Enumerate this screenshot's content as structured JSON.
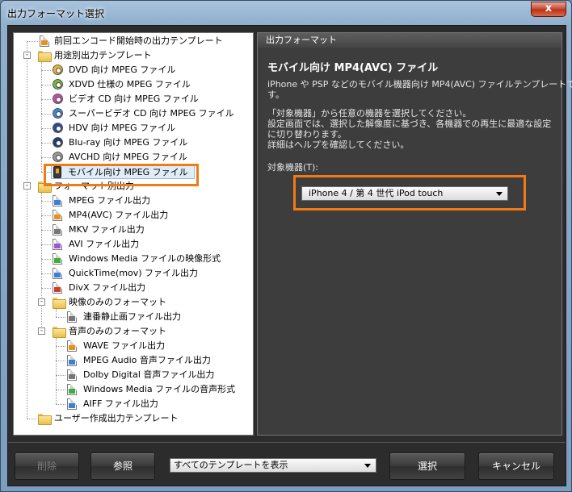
{
  "window": {
    "title": "出力フォーマット選択",
    "close_glyph": "x"
  },
  "tree": {
    "items": [
      {
        "label": "前回エンコード開始時の出力テンプレート"
      },
      {
        "label": "用途別出力テンプレート"
      },
      {
        "label": "DVD 向け MPEG ファイル"
      },
      {
        "label": "XDVD 仕様の MPEG ファイル"
      },
      {
        "label": "ビデオ CD 向け MPEG ファイル"
      },
      {
        "label": "スーパービデオ CD 向け MPEG ファイル"
      },
      {
        "label": "HDV 向け MPEG ファイル"
      },
      {
        "label": "Blu-ray 向け MPEG ファイル"
      },
      {
        "label": "AVCHD 向け MPEG ファイル"
      },
      {
        "label": "モバイル向け MPEG ファイル"
      },
      {
        "label": "フォーマット別出力"
      },
      {
        "label": "MPEG ファイル出力"
      },
      {
        "label": "MP4(AVC) ファイル出力"
      },
      {
        "label": "MKV ファイル出力"
      },
      {
        "label": "AVI ファイル出力"
      },
      {
        "label": "Windows Media ファイルの映像形式"
      },
      {
        "label": "QuickTime(mov) ファイル出力"
      },
      {
        "label": "DivX ファイル出力"
      },
      {
        "label": "映像のみのフォーマット"
      },
      {
        "label": "連番静止画ファイル出力"
      },
      {
        "label": "音声のみのフォーマット"
      },
      {
        "label": "WAVE ファイル出力"
      },
      {
        "label": "MPEG Audio 音声ファイル出力"
      },
      {
        "label": "Dolby Digital 音声ファイル出力"
      },
      {
        "label": "Windows Media ファイルの音声形式"
      },
      {
        "label": "AIFF ファイル出力"
      },
      {
        "label": "ユーザー作成出力テンプレート"
      }
    ],
    "expander_glyph": "-"
  },
  "panel": {
    "header": "出力フォーマット",
    "title": "モバイル向け MP4(AVC) ファイル",
    "desc_lines": [
      "iPhone や PSP などのモバイル機器向け MP4(AVC) ファイルテンプレートで",
      "す。",
      "「対象機器」から任意の機器を選択してください。",
      "設定画面では、選択した解像度に基づき、各機器での再生に最適な設定",
      "に切り替わります。",
      "詳細はヘルプを確認してください。"
    ],
    "device_label": "対象機器(T):",
    "device_value": "iPhone 4 / 第 4 世代 iPod touch"
  },
  "buttons": {
    "delete": "削除",
    "browse": "参照",
    "select": "選択",
    "cancel": "キャンセル"
  },
  "template_filter": {
    "value": "すべてのテンプレートを表示"
  },
  "colors": {
    "highlight": "#f07a14"
  }
}
